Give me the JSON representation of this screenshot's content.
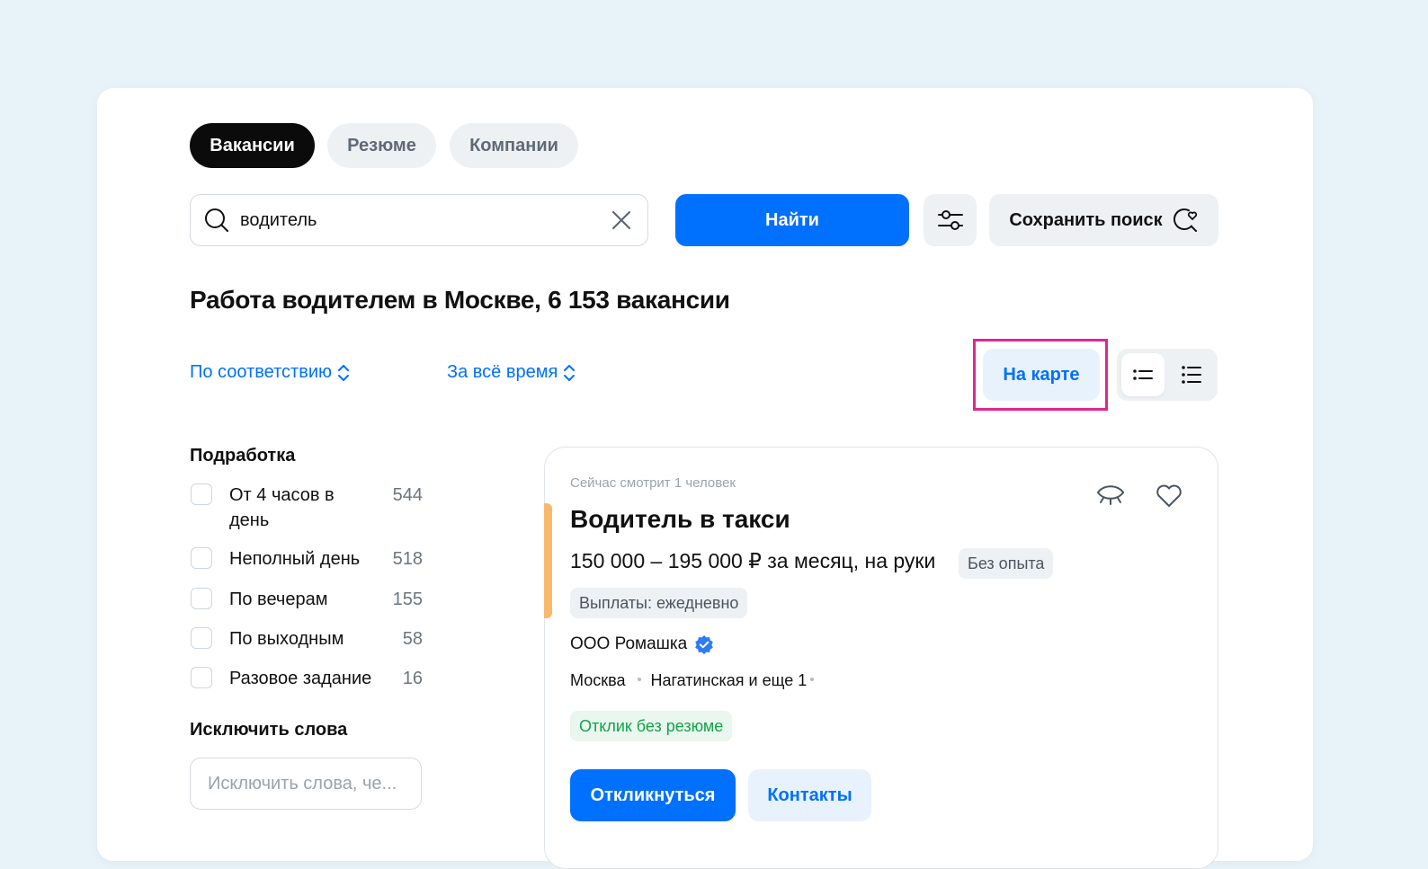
{
  "tabs": [
    {
      "label": "Вакансии",
      "active": true
    },
    {
      "label": "Резюме",
      "active": false
    },
    {
      "label": "Компании",
      "active": false
    }
  ],
  "search": {
    "value": "водитель",
    "find_label": "Найти",
    "save_label": "Сохранить поиск"
  },
  "results": {
    "heading": "Работа водителем в Москве, 6 153 вакансии",
    "sort_label": "По соответствию",
    "period_label": "За всё время",
    "map_label": "На карте"
  },
  "filters": {
    "part_time_title": "Подработка",
    "items": [
      {
        "label": "От 4 часов в день",
        "count": "544"
      },
      {
        "label": "Неполный день",
        "count": "518"
      },
      {
        "label": "По вечерам",
        "count": "155"
      },
      {
        "label": "По выходным",
        "count": "58"
      },
      {
        "label": "Разовое задание",
        "count": "16"
      }
    ],
    "exclude_title": "Исключить слова",
    "exclude_placeholder": "Исключить слова, че..."
  },
  "vacancy": {
    "viewing": "Сейчас смотрит 1 человек",
    "title": "Водитель в такси",
    "salary": "150 000 – 195 000 ₽ за месяц, на руки",
    "experience_tag": "Без опыта",
    "payout_tag": "Выплаты: ежедневно",
    "company": "ООО Ромашка",
    "city": "Москва",
    "metro": "Нагатинская и еще 1",
    "no_resume_tag": "Отклик без резюме",
    "apply_label": "Откликнуться",
    "contacts_label": "Контакты"
  },
  "colors": {
    "accent": "#0070ff",
    "highlight": "#e2268f",
    "card_stripe": "#f9b86c",
    "success": "#16a34a"
  }
}
